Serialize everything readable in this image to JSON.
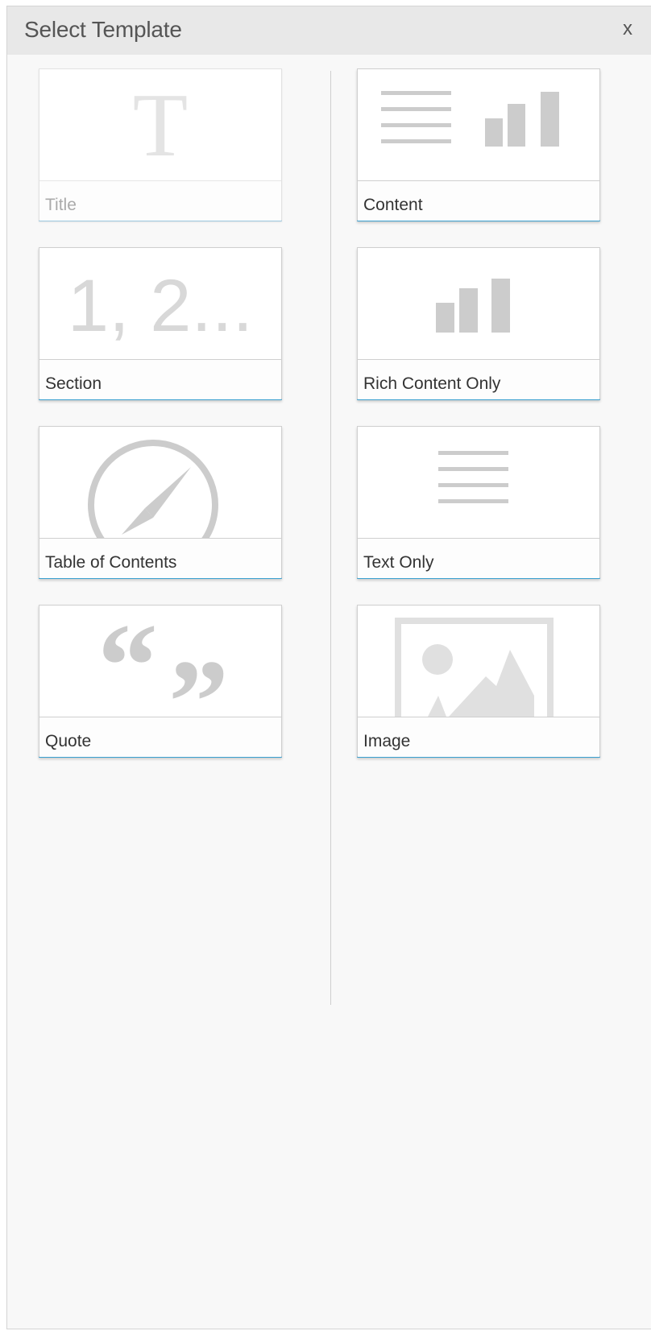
{
  "dialog": {
    "title": "Select Template",
    "close_label": "x"
  },
  "templates": [
    {
      "id": "title",
      "label": "Title",
      "icon": "serif-t-icon",
      "glyph": "T"
    },
    {
      "id": "content",
      "label": "Content",
      "icon": "text-and-chart-icon"
    },
    {
      "id": "section",
      "label": "Section",
      "icon": "numbering-icon",
      "glyph": "1, 2..."
    },
    {
      "id": "rich-content-only",
      "label": "Rich Content Only",
      "icon": "bar-chart-icon"
    },
    {
      "id": "table-of-contents",
      "label": "Table of Contents",
      "icon": "compass-icon"
    },
    {
      "id": "text-only",
      "label": "Text Only",
      "icon": "text-lines-icon"
    },
    {
      "id": "quote",
      "label": "Quote",
      "icon": "quote-marks-icon",
      "glyph_open": "“",
      "glyph_close": "”"
    },
    {
      "id": "image",
      "label": "Image",
      "icon": "image-placeholder-icon"
    }
  ],
  "colors": {
    "header_bg": "#e8e8e8",
    "panel_bg": "#f8f8f8",
    "accent_underline": "#3aa0d0",
    "icon_gray": "#cccccc"
  }
}
